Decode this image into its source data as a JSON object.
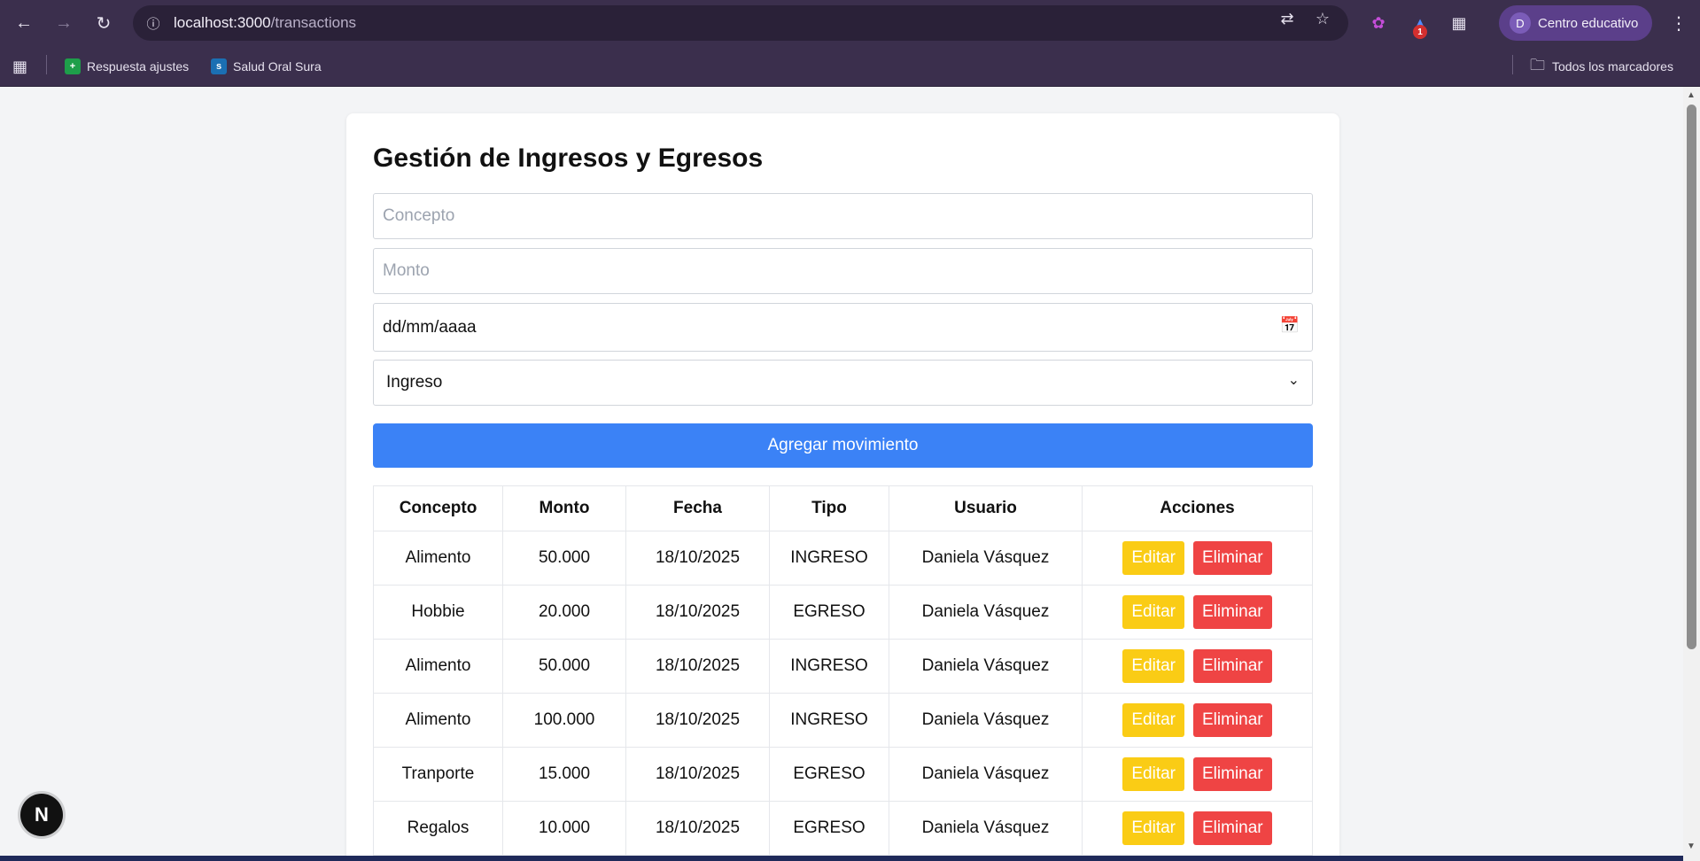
{
  "browser": {
    "url_host": "localhost:3000",
    "url_path": "/transactions",
    "profile_initial": "D",
    "profile_name": "Centro educativo",
    "ext_badge": "1",
    "bookmarks": [
      {
        "label": "Respuesta ajustes",
        "icon": "sheets-icon",
        "color": "#1e9e4a"
      },
      {
        "label": "Salud Oral Sura",
        "icon": "sura-icon",
        "color": "#1b6fb3"
      }
    ],
    "all_bookmarks": "Todos los marcadores"
  },
  "page": {
    "title": "Gestión de Ingresos y Egresos",
    "concept_placeholder": "Concepto",
    "amount_placeholder": "Monto",
    "date_placeholder": "dd/mm/aaaa",
    "type_selected": "Ingreso",
    "add_button": "Agregar movimiento",
    "table": {
      "headers": [
        "Concepto",
        "Monto",
        "Fecha",
        "Tipo",
        "Usuario",
        "Acciones"
      ],
      "rows": [
        {
          "concepto": "Alimento",
          "monto": "50.000",
          "fecha": "18/10/2025",
          "tipo": "INGRESO",
          "usuario": "Daniela Vásquez"
        },
        {
          "concepto": "Hobbie",
          "monto": "20.000",
          "fecha": "18/10/2025",
          "tipo": "EGRESO",
          "usuario": "Daniela Vásquez"
        },
        {
          "concepto": "Alimento",
          "monto": "50.000",
          "fecha": "18/10/2025",
          "tipo": "INGRESO",
          "usuario": "Daniela Vásquez"
        },
        {
          "concepto": "Alimento",
          "monto": "100.000",
          "fecha": "18/10/2025",
          "tipo": "INGRESO",
          "usuario": "Daniela Vásquez"
        },
        {
          "concepto": "Tranporte",
          "monto": "15.000",
          "fecha": "18/10/2025",
          "tipo": "EGRESO",
          "usuario": "Daniela Vásquez"
        },
        {
          "concepto": "Regalos",
          "monto": "10.000",
          "fecha": "18/10/2025",
          "tipo": "EGRESO",
          "usuario": "Daniela Vásquez"
        }
      ],
      "edit_label": "Editar",
      "delete_label": "Eliminar"
    },
    "next_indicator": "N"
  },
  "colors": {
    "primary": "#3b82f6",
    "edit": "#facc15",
    "delete": "#ef4444",
    "chrome": "#3b2f4d"
  }
}
